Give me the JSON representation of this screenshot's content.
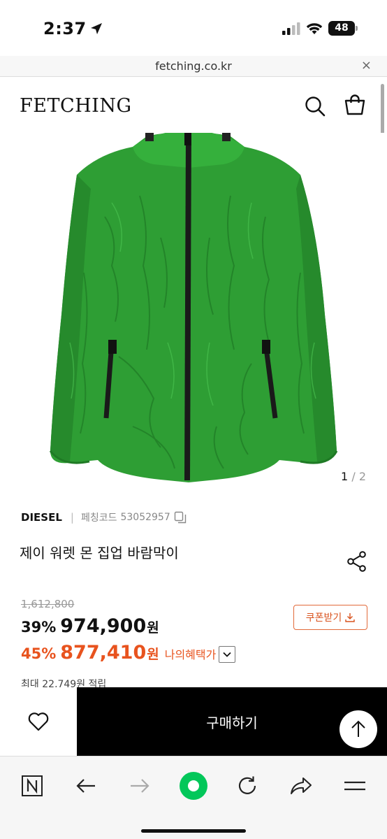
{
  "status_bar": {
    "time": "2:37",
    "battery": "48"
  },
  "browser": {
    "url": "fetching.co.kr",
    "close_label": "×"
  },
  "header": {
    "logo": "FETCHING"
  },
  "gallery": {
    "current": "1",
    "separator": "/",
    "total": "2"
  },
  "product": {
    "brand": "DIESEL",
    "code_label": "페칭코드",
    "code": "53052957",
    "title": "제이 워렛 몬 집업 바람막이",
    "original_price": "1,612,800",
    "discount": "39%",
    "price": "974,900",
    "currency": "원",
    "my_discount": "45%",
    "my_price": "877,410",
    "my_benefit_label": "나의혜택가",
    "points_text": "최대 22,749원 적립",
    "coupon_label": "쿠폰받기"
  },
  "actions": {
    "buy_label": "구매하기"
  },
  "colors": {
    "accent": "#e8531e",
    "jacket": "#2e9e34",
    "buy_bg": "#000000",
    "nav_green": "#03c75a"
  },
  "icons": {
    "location": "location-arrow-icon",
    "signal": "signal-icon",
    "wifi": "wifi-icon",
    "search": "search-icon",
    "bag": "shopping-bag-icon",
    "copy": "copy-icon",
    "share": "share-icon",
    "download": "download-icon",
    "chevron": "chevron-down-icon",
    "heart": "heart-icon",
    "arrow_up": "arrow-up-icon"
  }
}
